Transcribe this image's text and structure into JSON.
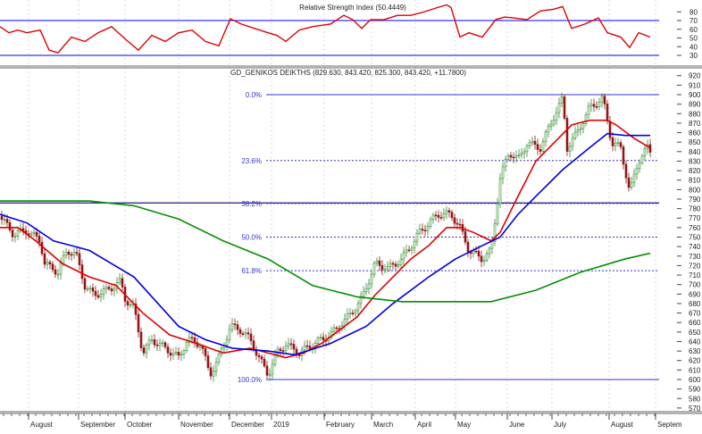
{
  "chart_data": {
    "type": "line",
    "subtype": "candlestick-with-moving-averages",
    "title": "GD_GENIKOS DEIKTHS (829.630, 843.420, 825.300, 843.420, +11.7800)",
    "ylim": [
      565,
      925
    ],
    "x_domain": [
      0,
      738
    ],
    "y_ticks": [
      920,
      910,
      900,
      890,
      880,
      870,
      860,
      850,
      840,
      830,
      820,
      810,
      800,
      790,
      780,
      770,
      760,
      750,
      740,
      730,
      720,
      710,
      700,
      690,
      680,
      670,
      660,
      650,
      640,
      630,
      620,
      610,
      600,
      590,
      580,
      570
    ],
    "x_ticks": [
      {
        "label": "August",
        "t": 32
      },
      {
        "label": "September",
        "t": 88
      },
      {
        "label": "October",
        "t": 140
      },
      {
        "label": "November",
        "t": 200
      },
      {
        "label": "December",
        "t": 257
      },
      {
        "label": "2019",
        "t": 304
      },
      {
        "label": "February",
        "t": 363
      },
      {
        "label": "March",
        "t": 416
      },
      {
        "label": "April",
        "t": 465
      },
      {
        "label": "May",
        "t": 510
      },
      {
        "label": "June",
        "t": 568
      },
      {
        "label": "July",
        "t": 618
      },
      {
        "label": "August",
        "t": 682
      },
      {
        "label": "Septem",
        "t": 734
      }
    ],
    "price_path": [
      [
        0,
        772
      ],
      [
        15,
        753
      ],
      [
        30,
        757
      ],
      [
        45,
        746
      ],
      [
        50,
        722
      ],
      [
        65,
        713
      ],
      [
        75,
        736
      ],
      [
        85,
        732
      ],
      [
        95,
        699
      ],
      [
        105,
        689
      ],
      [
        120,
        694
      ],
      [
        135,
        703
      ],
      [
        140,
        685
      ],
      [
        150,
        675
      ],
      [
        160,
        628
      ],
      [
        170,
        642
      ],
      [
        185,
        633
      ],
      [
        200,
        623
      ],
      [
        210,
        642
      ],
      [
        225,
        637
      ],
      [
        235,
        605
      ],
      [
        245,
        623
      ],
      [
        258,
        656
      ],
      [
        270,
        652
      ],
      [
        280,
        642
      ],
      [
        290,
        623
      ],
      [
        300,
        605
      ],
      [
        310,
        628
      ],
      [
        320,
        637
      ],
      [
        335,
        628
      ],
      [
        350,
        637
      ],
      [
        370,
        647
      ],
      [
        390,
        666
      ],
      [
        405,
        685
      ],
      [
        420,
        722
      ],
      [
        435,
        717
      ],
      [
        450,
        727
      ],
      [
        470,
        755
      ],
      [
        490,
        774
      ],
      [
        505,
        774
      ],
      [
        515,
        760
      ],
      [
        525,
        736
      ],
      [
        540,
        727
      ],
      [
        550,
        736
      ],
      [
        560,
        812
      ],
      [
        570,
        840
      ],
      [
        580,
        831
      ],
      [
        590,
        849
      ],
      [
        605,
        844
      ],
      [
        620,
        877
      ],
      [
        630,
        896
      ],
      [
        635,
        844
      ],
      [
        645,
        858
      ],
      [
        660,
        886
      ],
      [
        675,
        896
      ],
      [
        685,
        849
      ],
      [
        695,
        844
      ],
      [
        705,
        797
      ],
      [
        715,
        831
      ],
      [
        725,
        844
      ],
      [
        728,
        840
      ]
    ],
    "series": [
      {
        "name": "MA short",
        "color": "#e00000",
        "values": [
          [
            0,
            760
          ],
          [
            20,
            760
          ],
          [
            40,
            746
          ],
          [
            70,
            722
          ],
          [
            100,
            708
          ],
          [
            130,
            699
          ],
          [
            160,
            670
          ],
          [
            190,
            647
          ],
          [
            220,
            638
          ],
          [
            250,
            628
          ],
          [
            280,
            633
          ],
          [
            300,
            628
          ],
          [
            320,
            623
          ],
          [
            340,
            628
          ],
          [
            360,
            638
          ],
          [
            380,
            652
          ],
          [
            400,
            666
          ],
          [
            420,
            689
          ],
          [
            440,
            708
          ],
          [
            460,
            727
          ],
          [
            480,
            741
          ],
          [
            500,
            760
          ],
          [
            515,
            760
          ],
          [
            530,
            755
          ],
          [
            550,
            746
          ],
          [
            560,
            755
          ],
          [
            580,
            793
          ],
          [
            600,
            830
          ],
          [
            620,
            849
          ],
          [
            640,
            868
          ],
          [
            660,
            873
          ],
          [
            680,
            873
          ],
          [
            690,
            868
          ],
          [
            710,
            854
          ],
          [
            728,
            844
          ]
        ]
      },
      {
        "name": "MA medium",
        "color": "#0000e0",
        "values": [
          [
            0,
            774
          ],
          [
            30,
            765
          ],
          [
            60,
            746
          ],
          [
            100,
            736
          ],
          [
            150,
            708
          ],
          [
            200,
            656
          ],
          [
            230,
            642
          ],
          [
            260,
            633
          ],
          [
            300,
            630
          ],
          [
            330,
            626
          ],
          [
            370,
            638
          ],
          [
            410,
            656
          ],
          [
            440,
            680
          ],
          [
            480,
            708
          ],
          [
            510,
            727
          ],
          [
            540,
            741
          ],
          [
            560,
            750
          ],
          [
            580,
            774
          ],
          [
            600,
            793
          ],
          [
            630,
            821
          ],
          [
            660,
            844
          ],
          [
            680,
            859
          ],
          [
            700,
            857
          ],
          [
            728,
            857
          ]
        ]
      },
      {
        "name": "MA long",
        "color": "#009000",
        "values": [
          [
            0,
            788
          ],
          [
            100,
            788
          ],
          [
            150,
            783
          ],
          [
            200,
            769
          ],
          [
            250,
            746
          ],
          [
            300,
            727
          ],
          [
            350,
            699
          ],
          [
            400,
            687
          ],
          [
            450,
            682
          ],
          [
            500,
            682
          ],
          [
            550,
            682
          ],
          [
            600,
            694
          ],
          [
            650,
            713
          ],
          [
            700,
            727
          ],
          [
            728,
            733
          ]
        ]
      }
    ],
    "fibonacci": {
      "range": [
        600,
        900
      ],
      "levels": [
        {
          "label": "0.0%",
          "value": 900
        },
        {
          "label": "23.6%",
          "value": 830.6
        },
        {
          "label": "38.2%",
          "value": 785.4
        },
        {
          "label": "50.0%",
          "value": 750
        },
        {
          "label": "61.8%",
          "value": 714.6
        },
        {
          "label": "100.0%",
          "value": 600
        }
      ]
    },
    "support_line": 786,
    "rsi": {
      "title": "Relative Strength Index (50.4449)",
      "ylim": [
        25,
        85
      ],
      "y_ticks": [
        80,
        70,
        60,
        50,
        40,
        30
      ],
      "bands": [
        70,
        30
      ],
      "color": "#e00000",
      "values": [
        [
          0,
          63
        ],
        [
          10,
          56
        ],
        [
          20,
          59
        ],
        [
          30,
          56
        ],
        [
          45,
          59
        ],
        [
          55,
          36
        ],
        [
          65,
          33
        ],
        [
          80,
          51
        ],
        [
          95,
          46
        ],
        [
          110,
          56
        ],
        [
          125,
          63
        ],
        [
          140,
          49
        ],
        [
          155,
          36
        ],
        [
          170,
          53
        ],
        [
          185,
          46
        ],
        [
          200,
          56
        ],
        [
          215,
          59
        ],
        [
          230,
          46
        ],
        [
          245,
          41
        ],
        [
          258,
          72
        ],
        [
          270,
          66
        ],
        [
          285,
          61
        ],
        [
          300,
          56
        ],
        [
          310,
          53
        ],
        [
          320,
          46
        ],
        [
          335,
          59
        ],
        [
          350,
          63
        ],
        [
          370,
          66
        ],
        [
          385,
          76
        ],
        [
          395,
          71
        ],
        [
          405,
          61
        ],
        [
          415,
          71
        ],
        [
          430,
          71
        ],
        [
          445,
          76
        ],
        [
          460,
          76
        ],
        [
          475,
          80
        ],
        [
          490,
          85
        ],
        [
          500,
          88
        ],
        [
          505,
          85
        ],
        [
          515,
          51
        ],
        [
          525,
          56
        ],
        [
          540,
          51
        ],
        [
          555,
          71
        ],
        [
          565,
          74
        ],
        [
          575,
          73
        ],
        [
          590,
          71
        ],
        [
          605,
          81
        ],
        [
          620,
          83
        ],
        [
          630,
          86
        ],
        [
          640,
          61
        ],
        [
          655,
          66
        ],
        [
          670,
          73
        ],
        [
          680,
          56
        ],
        [
          695,
          51
        ],
        [
          705,
          39
        ],
        [
          715,
          56
        ],
        [
          728,
          51
        ]
      ]
    }
  }
}
